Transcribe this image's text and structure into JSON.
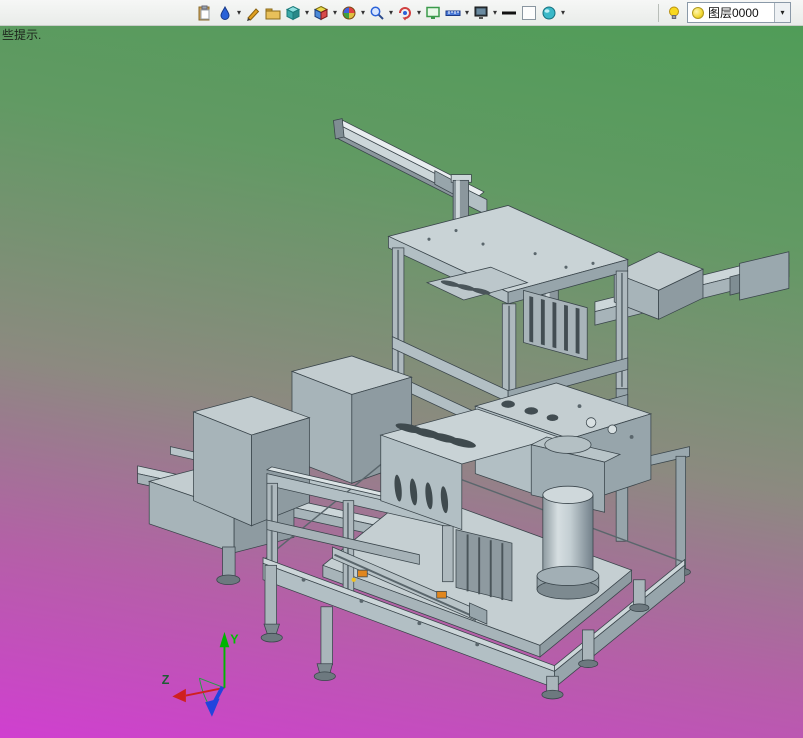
{
  "hint": {
    "text": "些提示."
  },
  "toolbar": {
    "icons": [
      {
        "name": "paste"
      },
      {
        "name": "color-dropper"
      },
      {
        "name": "pencil"
      },
      {
        "name": "folder"
      },
      {
        "name": "cube"
      },
      {
        "name": "material-cube"
      },
      {
        "name": "palette"
      },
      {
        "name": "zoom"
      },
      {
        "name": "rotate-view"
      },
      {
        "name": "display"
      },
      {
        "name": "ruler"
      },
      {
        "name": "monitor"
      },
      {
        "name": "line-width"
      },
      {
        "name": "background"
      },
      {
        "name": "visibility"
      },
      {
        "name": "light"
      }
    ],
    "layer_selector": {
      "value": "图层0000"
    }
  },
  "viewport": {
    "gradient_top": "#509c58",
    "gradient_bottom": "#d03fd0",
    "triad": {
      "y_label": "Y",
      "z_label": "Z"
    }
  }
}
